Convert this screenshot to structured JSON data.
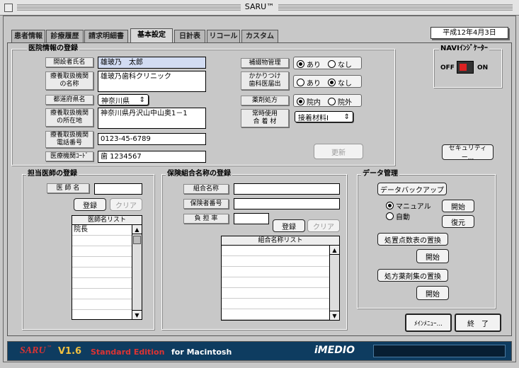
{
  "app": {
    "title": "SARU™"
  },
  "tabs": [
    "患者情報",
    "診療履歴",
    "請求明細書",
    "基本設定",
    "日計表",
    "リコール",
    "カスタム"
  ],
  "date": "平成12年4月3日",
  "clinic": {
    "section_title": "医院情報の登録",
    "owner_label": "開設者氏名",
    "owner_value": "雄玻乃　太郎",
    "name_label": "療養取扱機関\nの名称",
    "name_value": "雄玻乃歯科クリニック",
    "pref_label": "都道府県名",
    "pref_value": "神奈川県",
    "addr_label": "療養取扱機関\nの所在地",
    "addr_value": "神奈川県丹沢山中山奥1－1",
    "tel_label": "療養取扱機関\n電話番号",
    "tel_value": "0123-45-6789",
    "code_label": "医療機関ｺｰﾄﾞ",
    "code_value": "歯 1234567",
    "sanitary_label": "補綴物管理",
    "sanitary_yes": "あり",
    "sanitary_no": "なし",
    "family_label": "かかりつけ\n歯科医届出",
    "family_yes": "あり",
    "family_no": "なし",
    "rx_label": "薬剤処方",
    "rx_in": "院内",
    "rx_out": "院外",
    "material_label": "常時使用\n合 着 材",
    "material_value": "接着材料Ⅰ",
    "update_button": "更新"
  },
  "navi": {
    "title": "NAVIｲﾝｼﾞｹｰﾀｰ",
    "off": "OFF",
    "on": "ON"
  },
  "security_button": "セキュリティー...",
  "doctor": {
    "section_title": "担当医師の登録",
    "name_label": "医 師 名",
    "name_value": "",
    "register": "登録",
    "clear": "クリア",
    "list_header": "医師名リスト",
    "list": [
      "院長"
    ]
  },
  "insurance": {
    "section_title": "保険組合名称の登録",
    "union_label": "組合名称",
    "insurer_label": "保険者番号",
    "ratio_label": "負 担 率",
    "register": "登録",
    "clear": "クリア",
    "list_header": "組合名称リスト"
  },
  "data": {
    "section_title": "データ管理",
    "backup": "データバックアップ",
    "manual": "マニュアル",
    "auto": "自動",
    "start": "開始",
    "restore": "復元",
    "replace_points": "処置点数表の置換",
    "start2": "開始",
    "replace_rx": "処方薬剤集の置換",
    "start3": "開始"
  },
  "footer": {
    "main_menu": "ﾒｲﾝﾒﾆｭｰ...",
    "exit": "終　了",
    "brand": "SARU",
    "tm": "™",
    "version": "V1.6",
    "edition": "Standard Edition",
    "platform": "for Macintosh",
    "logo": "iMEDIO"
  }
}
